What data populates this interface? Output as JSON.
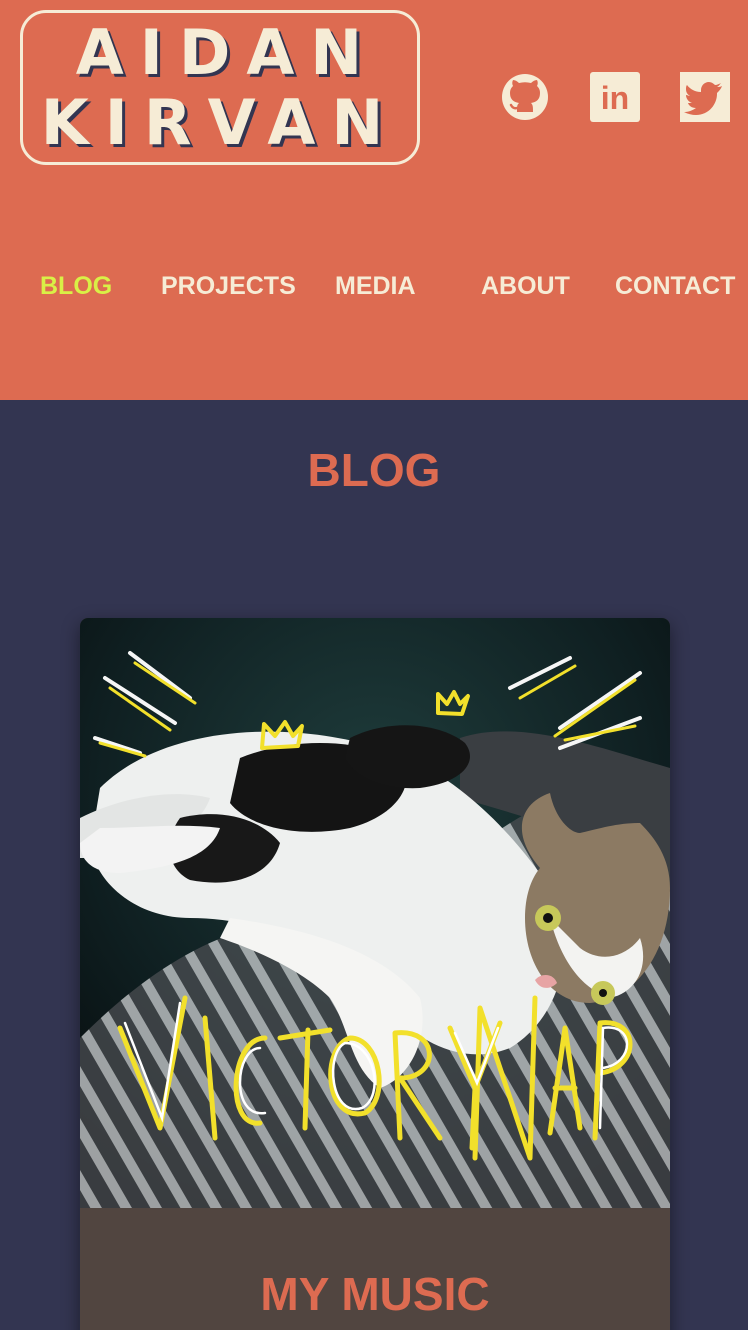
{
  "header": {
    "logo_line1": "AIDAN",
    "logo_line2": "KIRVAN",
    "social": [
      {
        "name": "GitHub",
        "icon": "github-icon"
      },
      {
        "name": "LinkedIn",
        "icon": "linkedin-icon",
        "glyph": "in"
      },
      {
        "name": "Twitter",
        "icon": "twitter-icon"
      }
    ]
  },
  "nav": {
    "items": [
      {
        "label": "BLOG",
        "active": true
      },
      {
        "label": "PROJECTS",
        "active": false
      },
      {
        "label": "MEDIA",
        "active": false
      },
      {
        "label": "ABOUT",
        "active": false
      },
      {
        "label": "CONTACT",
        "active": false
      }
    ]
  },
  "main": {
    "title": "BLOG",
    "posts": [
      {
        "title": "MY MUSIC",
        "image_caption_art": "VICTORY NAP"
      }
    ]
  },
  "colors": {
    "header_bg": "#dd6b51",
    "page_bg": "#333551",
    "cream": "#f6ecd6",
    "active_nav": "#d9f046",
    "card_footer": "#514540"
  }
}
